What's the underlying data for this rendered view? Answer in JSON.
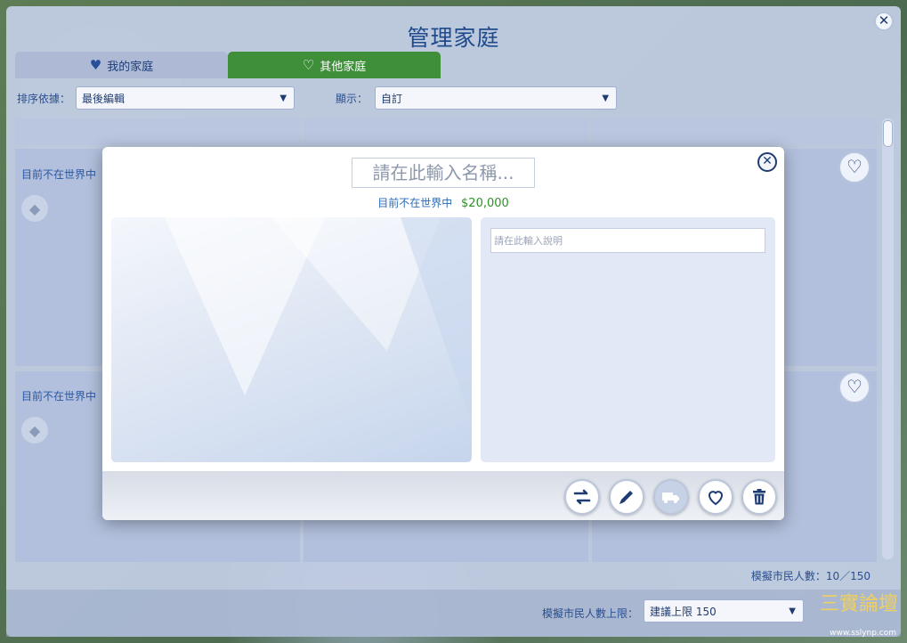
{
  "panel": {
    "title": "管理家庭",
    "close_glyph": "✕"
  },
  "tabs": [
    {
      "label": "我的家庭",
      "icon": "heart-filled-icon"
    },
    {
      "label": "其他家庭",
      "icon": "heart-outline-icon"
    }
  ],
  "filters": {
    "sort_label": "排序依據：",
    "sort_value": "最後編輯",
    "show_label": "顯示：",
    "show_value": "自訂"
  },
  "cards": {
    "status_1": "目前不在世界中",
    "status_2": "目前不在世界中"
  },
  "footer": {
    "population": "模擬市民人數：10／150",
    "cap_label": "模擬市民人數上限：",
    "cap_value": "建議上限 150"
  },
  "modal": {
    "name_placeholder": "請在此輸入名稱...",
    "status": "目前不在世界中",
    "funds": "$20,000",
    "description_placeholder": "請在此輸入說明",
    "close_glyph": "✕",
    "actions": [
      {
        "name": "switch-household",
        "icon": "swap-arrows-icon"
      },
      {
        "name": "edit-household",
        "icon": "pencil-icon"
      },
      {
        "name": "move-household",
        "icon": "truck-icon",
        "enabled": false
      },
      {
        "name": "favorite-household",
        "icon": "heart-outline-icon"
      },
      {
        "name": "delete-household",
        "icon": "trash-icon"
      }
    ]
  },
  "watermark": {
    "text": "三實論壇",
    "url": "www.sslynp.com"
  },
  "colors": {
    "title_blue": "#1f4a8c",
    "tab_active_green": "#3e8e3a",
    "funds_green": "#2f8f2a"
  }
}
